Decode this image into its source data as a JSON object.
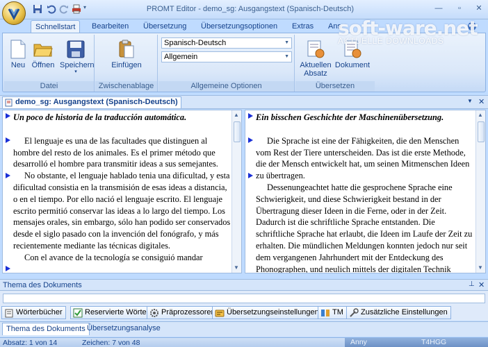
{
  "window": {
    "title": "PROMT Editor - demo_sg: Ausgangstext (Spanisch-Deutsch)",
    "controls": {
      "minimize": "—",
      "restore": "▫",
      "close": "✕"
    }
  },
  "watermark": {
    "main": "soft-ware.net",
    "sub": "AKTUELLE DOWNLOADS"
  },
  "ribbon": {
    "tabs": [
      {
        "label": "Schnellstart",
        "active": true
      },
      {
        "label": "Bearbeiten"
      },
      {
        "label": "Übersetzung"
      },
      {
        "label": "Übersetzungsoptionen"
      },
      {
        "label": "Extras"
      },
      {
        "label": "Ans"
      }
    ],
    "groups": {
      "datei": {
        "label": "Datei",
        "buttons": [
          "Neu",
          "Öffnen",
          "Speichern"
        ]
      },
      "clipboard": {
        "label": "Zwischenablage",
        "buttons": [
          "Einfügen"
        ]
      },
      "options": {
        "label": "Allgemeine Optionen",
        "direction": "Spanisch-Deutsch",
        "profile": "Allgemein"
      },
      "translate": {
        "label": "Übersetzen",
        "buttons": [
          "Aktuellen\nAbsatz",
          "Dokument"
        ]
      }
    }
  },
  "document_tab": {
    "label": "demo_sg: Ausgangstext (Spanisch-Deutsch)"
  },
  "source_pane": {
    "title": "Un poco de historia de la traducción automática.",
    "p1": "El lenguaje es una de las facultades que distinguen al hombre del resto de los animales. Es el primer método que desarrolló el hombre para transmitir ideas a sus semejantes.",
    "p2": "No obstante, el lenguaje hablado tenia una dificultad,  y esta dificultad consistia en la transmisión de esas ideas a distancia, o en el tiempo. Por ello nació el lenguaje escrito. El lenguaje escrito permitió conservar las ideas a lo largo del tiempo. Los mensajes orales, sin embargo, sólo han podido ser conservados desde el siglo pasado con la invención del fonógrafo, y más recientemente mediante las técnicas digitales.",
    "p3": "Con el avance de la tecnología se consiguió mandar"
  },
  "target_pane": {
    "title": "Ein bisschen Geschichte der Maschinenübersetzung.",
    "p1": "Die Sprache ist eine der Fähigkeiten, die den Menschen vom Rest der Tiere unterscheiden. Das ist die erste Methode, die der Mensch entwickelt hat, um seinen Mitmenschen Ideen zu übertragen.",
    "p2": "Dessenungeachtet hatte die gesprochene Sprache eine Schwierigkeit, und diese Schwierigkeit bestand in der Übertragung dieser Ideen in die Ferne, oder in der Zeit. Dadurch ist die schriftliche Sprache entstanden. Die schriftliche Sprache hat erlaubt, die Ideen im Laufe der Zeit zu erhalten. Die mündlichen Meldungen konnten jedoch nur seit dem vergangenen Jahrhundert mit der Entdeckung des Phonographen, und neulich mittels der digitalen Technik"
  },
  "theme_panel": {
    "title": "Thema des Dokuments",
    "buttons": [
      "Wörterbücher",
      "Reservierte Wörter",
      "Präprozessoren",
      "Übersetzungseinstellungen",
      "TM",
      "Zusätzliche Einstellungen"
    ]
  },
  "bottom_tabs": [
    {
      "label": "Thema des Dokuments",
      "active": true
    },
    {
      "label": "Übersetzungsanalyse"
    }
  ],
  "status": {
    "paragraph": "Absatz: 1 von 14",
    "chars": "Zeichen: 7 von 48",
    "field1": "Anny",
    "field2": "T4HGG"
  },
  "colors": {
    "accent": "#15428b",
    "ribbon_bg": "#dbe8f9",
    "marker": "#1a2fd6"
  }
}
